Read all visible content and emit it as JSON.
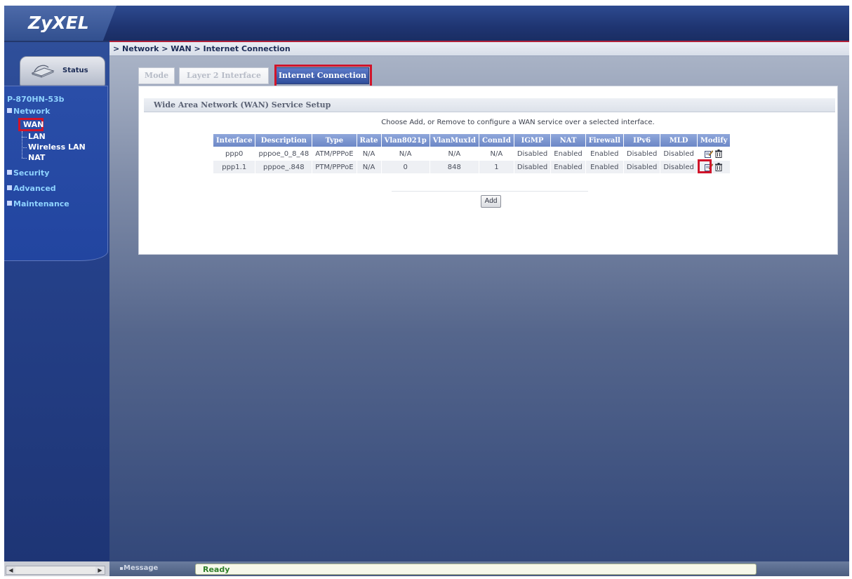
{
  "app": {
    "logo": "ZyXEL"
  },
  "breadcrumb": "> Network > WAN > Internet Connection",
  "sidebar": {
    "status_label": "Status",
    "device_name": "P-870HN-53b",
    "items": [
      {
        "label": "Network"
      },
      {
        "label": "WAN"
      },
      {
        "label": "LAN"
      },
      {
        "label": "Wireless LAN"
      },
      {
        "label": "NAT"
      },
      {
        "label": "Security"
      },
      {
        "label": "Advanced"
      },
      {
        "label": "Maintenance"
      }
    ]
  },
  "tabs": [
    {
      "label": "Mode"
    },
    {
      "label": "Layer 2 Interface"
    },
    {
      "label": "Internet Connection"
    }
  ],
  "panel": {
    "title": "Wide Area Network (WAN) Service Setup",
    "instructions": "Choose Add, or Remove to configure a WAN service over a selected interface.",
    "add_button": "Add"
  },
  "table": {
    "headers": [
      "Interface",
      "Description",
      "Type",
      "Rate",
      "Vlan8021p",
      "VlanMuxId",
      "ConnId",
      "IGMP",
      "NAT",
      "Firewall",
      "IPv6",
      "MLD",
      "Modify"
    ],
    "rows": [
      [
        "ppp0",
        "pppoe_0_8_48",
        "ATM/PPPoE",
        "N/A",
        "N/A",
        "N/A",
        "N/A",
        "Disabled",
        "Enabled",
        "Enabled",
        "Disabled",
        "Disabled"
      ],
      [
        "ppp1.1",
        "pppoe_.848",
        "PTM/PPPoE",
        "N/A",
        "0",
        "848",
        "1",
        "Disabled",
        "Enabled",
        "Enabled",
        "Disabled",
        "Disabled"
      ]
    ]
  },
  "status_bar": {
    "message_label": "Message",
    "message": "Ready"
  },
  "colors": {
    "highlight": "#d0142a",
    "header_blue": "#6c87c6",
    "ready_green": "#2f7f2a"
  }
}
